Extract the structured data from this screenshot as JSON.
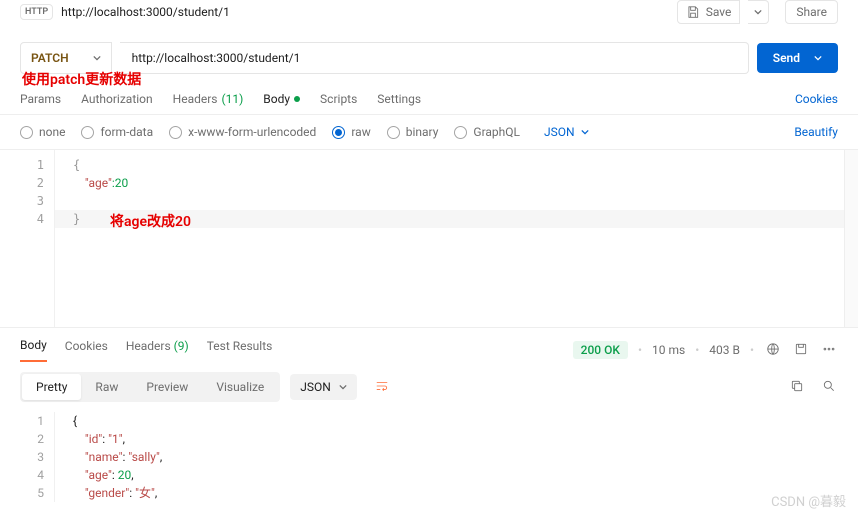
{
  "topbar": {
    "badge": "HTTP",
    "url": "http://localhost:3000/student/1",
    "save": "Save",
    "share": "Share"
  },
  "request": {
    "method": "PATCH",
    "url": "http://localhost:3000/student/1",
    "send": "Send"
  },
  "annotation1": "使用patch更新数据",
  "tabs": {
    "params": "Params",
    "auth": "Authorization",
    "headers": "Headers",
    "headers_count": "(11)",
    "body": "Body",
    "scripts": "Scripts",
    "settings": "Settings",
    "cookies": "Cookies"
  },
  "bodytype": {
    "none": "none",
    "form": "form-data",
    "xform": "x-www-form-urlencoded",
    "raw": "raw",
    "binary": "binary",
    "graphql": "GraphQL",
    "json": "JSON",
    "beautify": "Beautify"
  },
  "req_body": {
    "lines": [
      "1",
      "2",
      "3",
      "4"
    ],
    "l1": "{",
    "l2_key": "\"age\"",
    "l2_val": ":20",
    "l4": "}"
  },
  "annotation2": "将age改成20",
  "resp_tabs": {
    "body": "Body",
    "cookies": "Cookies",
    "headers": "Headers",
    "headers_count": "(9)",
    "tests": "Test Results"
  },
  "resp_meta": {
    "status": "200 OK",
    "time": "10 ms",
    "size": "403 B"
  },
  "format": {
    "pretty": "Pretty",
    "raw": "Raw",
    "preview": "Preview",
    "visualize": "Visualize",
    "json": "JSON"
  },
  "resp_body": {
    "lines": [
      "1",
      "2",
      "3",
      "4",
      "5"
    ],
    "l1": "{",
    "l2": {
      "k": "\"id\"",
      "v": "\"1\""
    },
    "l3": {
      "k": "\"name\"",
      "v": "\"sally\""
    },
    "l4": {
      "k": "\"age\"",
      "v": "20"
    },
    "l5": {
      "k": "\"gender\"",
      "v": "\"女\""
    }
  },
  "watermark": "CSDN @暮毅"
}
